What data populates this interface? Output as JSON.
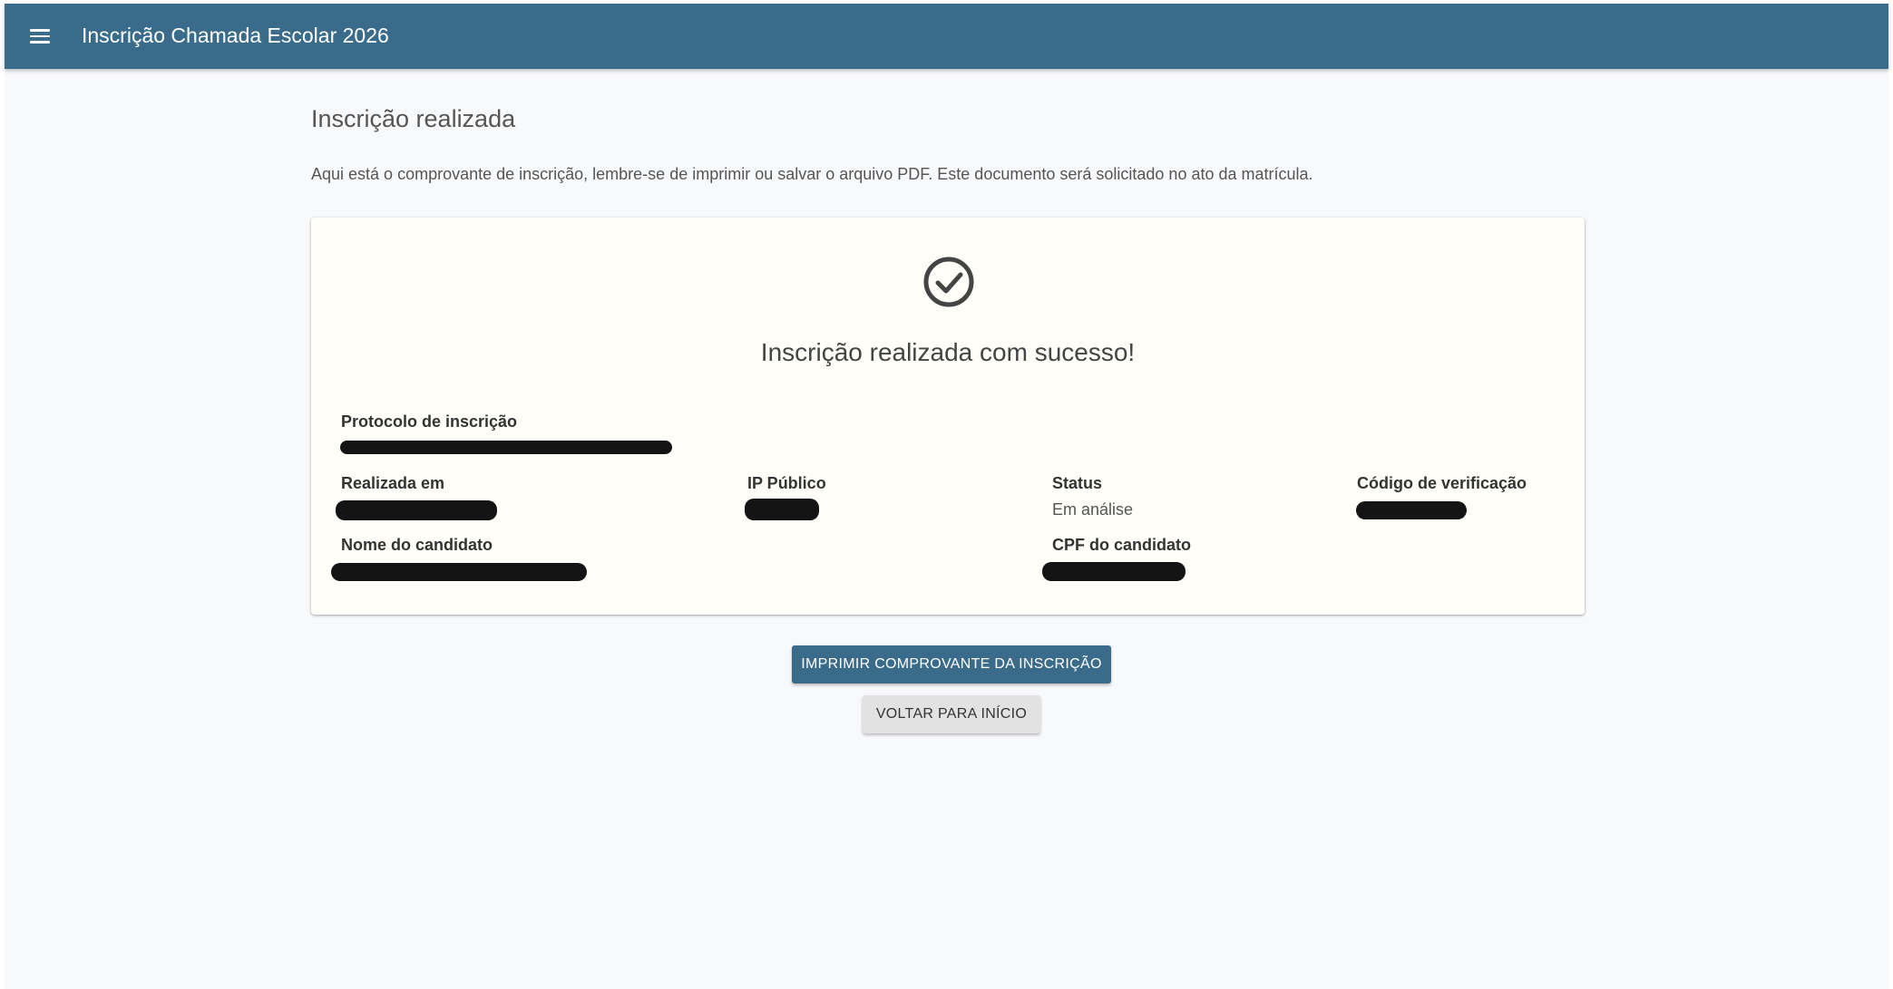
{
  "header": {
    "menu_icon": "menu-icon",
    "title": "Inscrição Chamada Escolar 2026",
    "background_color": "#3a6b8a"
  },
  "page": {
    "title": "Inscrição realizada",
    "instruction": "Aqui está o comprovante de inscrição, lembre-se de imprimir ou salvar o arquivo PDF. Este documento será solicitado no ato da matrícula."
  },
  "card": {
    "status_icon": "check-circle-icon",
    "success_message": "Inscrição realizada com sucesso!",
    "fields": {
      "protocol_label": "Protocolo de inscrição",
      "date_label": "Realizada em",
      "ip_label": "IP Público",
      "status_label": "Status",
      "status_value": "Em análise",
      "verification_label": "Código de verificação",
      "name_label": "Nome do candidato",
      "cpf_label": "CPF do candidato"
    }
  },
  "actions": {
    "print_label": "IMPRIMIR COMPROVANTE DA INSCRIÇÃO",
    "back_label": "VOLTAR PARA INÍCIO"
  }
}
